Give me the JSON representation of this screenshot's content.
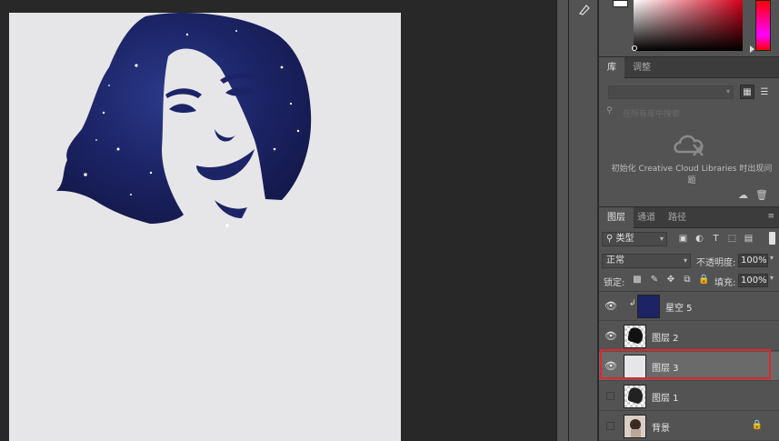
{
  "libraries_panel": {
    "tabs": [
      "库",
      "调整"
    ],
    "search_placeholder": "在所有库中搜索",
    "message": "初始化 Creative Cloud Libraries 时出现问题"
  },
  "layers_panel": {
    "tabs": [
      "图层",
      "通道",
      "路径"
    ],
    "filter_kind": "类型",
    "blend_mode": "正常",
    "opacity_label": "不透明度:",
    "opacity_value": "100%",
    "lock_label": "锁定:",
    "fill_label": "填充:",
    "fill_value": "100%",
    "layers": [
      {
        "name": "星空 5",
        "visible": true,
        "clipped": true
      },
      {
        "name": "图层 2",
        "visible": true
      },
      {
        "name": "图层 3",
        "visible": true,
        "selected": true
      },
      {
        "name": "图层 1",
        "visible": false
      },
      {
        "name": "背景",
        "visible": false,
        "locked": true
      }
    ]
  },
  "colors": {
    "highlight": "#e0262b",
    "canvas_bg": "#e6e6e8",
    "starfield": "#1c2466"
  }
}
